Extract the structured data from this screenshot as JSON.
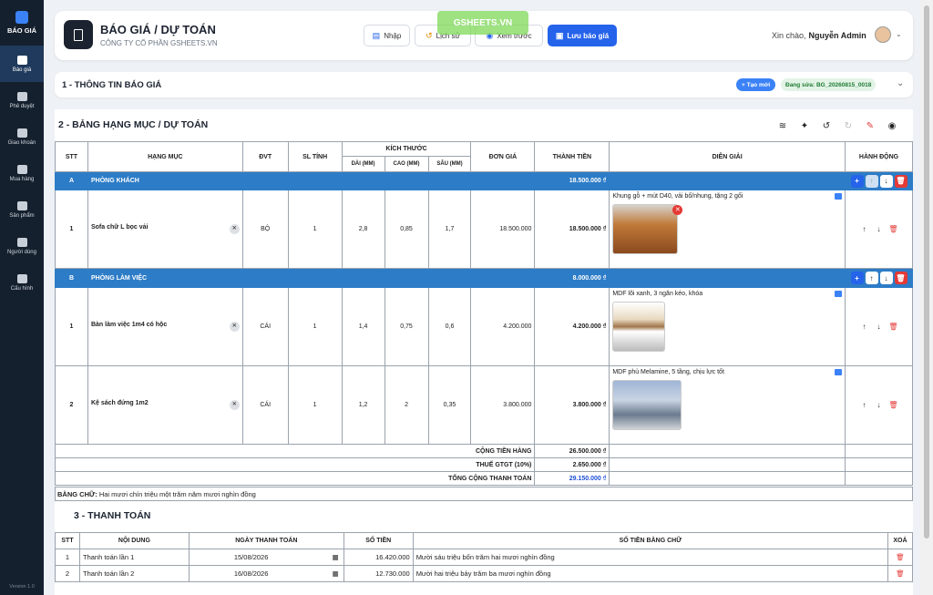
{
  "sidebar": {
    "logo": "BÁO GIÁ",
    "items": [
      {
        "label": "Báo giá"
      },
      {
        "label": "Phê duyệt"
      },
      {
        "label": "Giao khoán"
      },
      {
        "label": "Mua hàng"
      },
      {
        "label": "Sản phẩm"
      },
      {
        "label": "Người dùng"
      },
      {
        "label": "Cấu hình"
      }
    ],
    "version": "Version 1.0"
  },
  "header": {
    "title": "BÁO GIÁ / DỰ TOÁN",
    "subtitle": "CÔNG TY CỔ PHẦN GSHEETS.VN",
    "btn_import": "Nhập",
    "btn_history": "Lịch sử",
    "btn_preview": "Xem trước",
    "btn_save": "Lưu báo giá",
    "greeting": "Xin chào,",
    "user": "Nguyễn Admin",
    "watermark": "GSHEETS.VN"
  },
  "section1": {
    "title": "1 - THÔNG TIN BÁO GIÁ",
    "btn_new": "+ Tạo mới",
    "editing": "Đang sửa: BG_20260815_0018"
  },
  "section2": {
    "title": "2 - BẢNG HẠNG MỤC / DỰ TOÁN",
    "headers": {
      "stt": "STT",
      "item": "HẠNG MỤC",
      "unit": "ĐVT",
      "qty": "SL TÍNH",
      "size": "KÍCH THƯỚC",
      "len": "DÀI (MM)",
      "height": "CAO (MM)",
      "depth": "SÂU (MM)",
      "price": "ĐƠN GIÁ",
      "amount": "THÀNH TIỀN",
      "desc": "DIỄN GIẢI",
      "actions": "HÀNH ĐỘNG"
    },
    "groups": [
      {
        "code": "A",
        "name": "PHÒNG KHÁCH",
        "total": "18.500.000 ₫",
        "rows": [
          {
            "stt": "1",
            "name": "Sofa chữ L bọc vải",
            "unit": "BỘ",
            "qty": "1",
            "len": "2,8",
            "height": "0,85",
            "depth": "1,7",
            "price": "18.500.000",
            "amount": "18.500.000 ₫",
            "desc": "Khung gỗ + mút D40, vải bố/nhung, tặng 2 gối"
          }
        ]
      },
      {
        "code": "B",
        "name": "PHÒNG LÀM VIỆC",
        "total": "8.000.000 ₫",
        "rows": [
          {
            "stt": "1",
            "name": "Bàn làm việc 1m4 có hộc",
            "unit": "CÁI",
            "qty": "1",
            "len": "1,4",
            "height": "0,75",
            "depth": "0,6",
            "price": "4.200.000",
            "amount": "4.200.000 ₫",
            "desc": "MDF lõi xanh, 3 ngăn kéo, khóa"
          },
          {
            "stt": "2",
            "name": "Kệ sách đứng 1m2",
            "unit": "CÁI",
            "qty": "1",
            "len": "1,2",
            "height": "2",
            "depth": "0,35",
            "price": "3.800.000",
            "amount": "3.800.000 ₫",
            "desc": "MDF phủ Melamine, 5 tầng, chịu lực tốt"
          }
        ]
      }
    ],
    "subtotal_label": "CỘNG TIỀN HÀNG",
    "subtotal": "26.500.000 ₫",
    "vat_label": "THUẾ GTGT (10%)",
    "vat": "2.650.000 ₫",
    "grand_label": "TỔNG CỘNG THANH TOÁN",
    "grand": "29.150.000 ₫",
    "words_label": "BẰNG CHỮ:",
    "words": "Hai mươi chín triệu một trăm năm mươi nghìn đồng"
  },
  "section3": {
    "title": "3 - THANH TOÁN",
    "headers": {
      "stt": "STT",
      "content": "NỘI DUNG",
      "date": "NGÀY THANH TOÁN",
      "amount": "SỐ TIỀN",
      "words": "SỐ TIỀN BẰNG CHỮ",
      "del": "XOÁ"
    },
    "rows": [
      {
        "stt": "1",
        "content": "Thanh toán lần 1",
        "date": "15/08/2026",
        "amount": "16.420.000",
        "words": "Mười sáu triệu bốn trăm hai mươi nghìn đồng"
      },
      {
        "stt": "2",
        "content": "Thanh toán lần 2",
        "date": "16/08/2026",
        "amount": "12.730.000",
        "words": "Mười hai triệu bảy trăm ba mươi nghìn đồng"
      }
    ]
  }
}
